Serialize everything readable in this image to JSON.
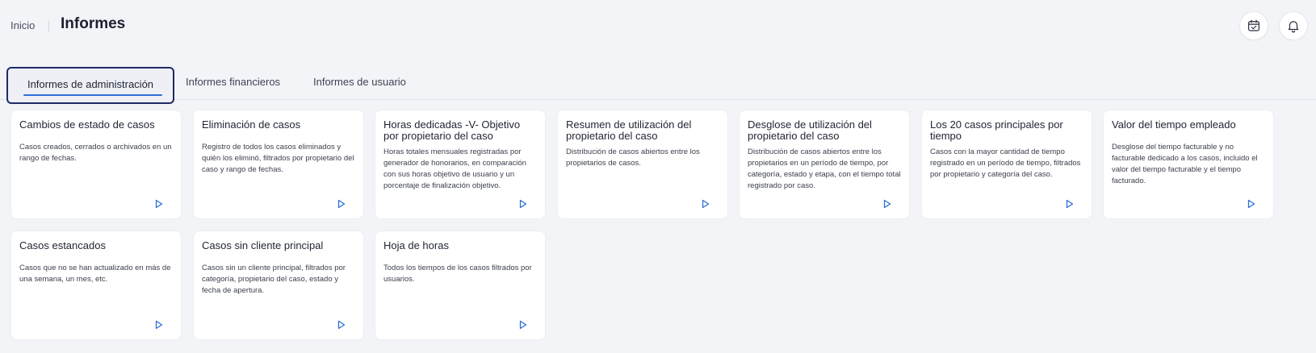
{
  "header": {
    "breadcrumb_home": "Inicio",
    "title": "Informes",
    "calendar_icon": "calendar-check-icon",
    "bell_icon": "bell-icon"
  },
  "tabs": [
    {
      "label": "Informes de administración",
      "active": true
    },
    {
      "label": "Informes financieros",
      "active": false
    },
    {
      "label": "Informes de usuario",
      "active": false
    }
  ],
  "colors": {
    "accent": "#2f6fd6",
    "tab_outline": "#1f2a66",
    "background": "#f3f4f8"
  },
  "cards": [
    {
      "title": "Cambios de estado de casos",
      "desc": "Casos creados, cerrados o archivados en un rango de fechas."
    },
    {
      "title": "Eliminación de casos",
      "desc": "Registro de todos los casos eliminados y quién los eliminó, filtrados por propietario del caso y rango de fechas."
    },
    {
      "title": "Horas dedicadas -V- Objetivo por propietario del caso",
      "desc": "Horas totales mensuales registradas por generador de honorarios, en comparación con sus horas objetivo de usuario y un porcentaje de finalización objetivo."
    },
    {
      "title": "Resumen de utilización del propietario del caso",
      "desc": "Distribución de casos abiertos entre los propietarios de casos."
    },
    {
      "title": "Desglose de utilización del propietario del caso",
      "desc": "Distribución de casos abiertos entre los propietarios en un período de tiempo, por categoría, estado y etapa, con el tiempo total registrado por caso."
    },
    {
      "title": "Los 20 casos principales por tiempo",
      "desc": "Casos con la mayor cantidad de tiempo registrado en un período de tiempo, filtrados por propietario y categoría del caso."
    },
    {
      "title": "Valor del tiempo empleado",
      "desc": "Desglose del tiempo facturable y no facturable dedicado a los casos, incluido el valor del tiempo facturable y el tiempo facturado."
    },
    {
      "title": "Casos estancados",
      "desc": "Casos que no se han actualizado en más de una semana, un mes, etc."
    },
    {
      "title": "Casos sin cliente principal",
      "desc": "Casos sin un cliente principal, filtrados por categoría, propietario del caso, estado y fecha de apertura."
    },
    {
      "title": "Hoja de horas",
      "desc": "Todos los tiempos de los casos filtrados por usuarios."
    }
  ],
  "card_action_icon": "play-icon"
}
